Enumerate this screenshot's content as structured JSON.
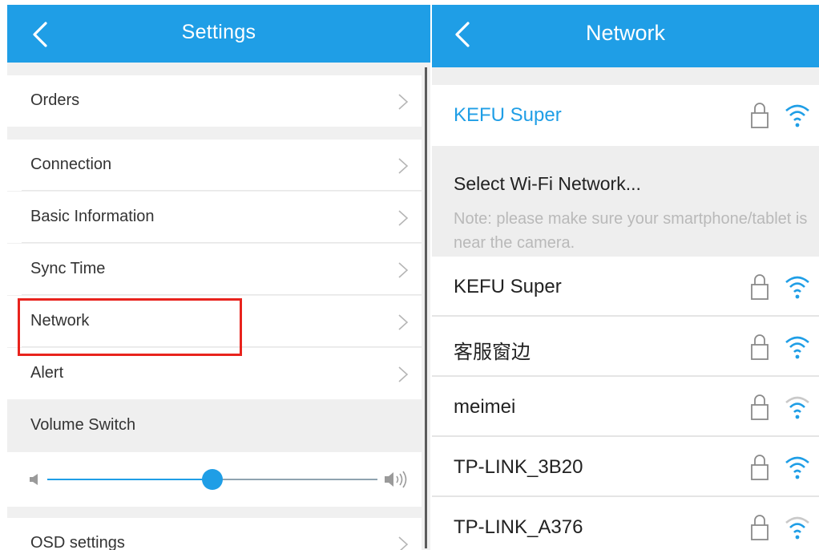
{
  "settings": {
    "title": "Settings",
    "items": [
      {
        "label": "Orders"
      },
      {
        "label": "Connection"
      },
      {
        "label": "Basic Information"
      },
      {
        "label": "Sync Time"
      },
      {
        "label": "Network"
      },
      {
        "label": "Alert"
      },
      {
        "label": "Volume Switch"
      },
      {
        "label": "OSD settings"
      }
    ],
    "volume_level": 0.5,
    "highlight_color": "#e8231d"
  },
  "network": {
    "title": "Network",
    "current_network": "KEFU Super",
    "select_heading": "Select Wi-Fi Network...",
    "select_note": "Note: please make sure your smartphone/tablet is near the camera.",
    "networks": [
      {
        "name": "KEFU Super"
      },
      {
        "name": "客服窗边"
      },
      {
        "name": "meimei"
      },
      {
        "name": "TP-LINK_3B20"
      },
      {
        "name": "TP-LINK_A376"
      }
    ]
  },
  "colors": {
    "accent": "#1f9ee6",
    "background": "#f0f0f0"
  },
  "icons": [
    "back-arrow-icon",
    "chevron-right-icon",
    "speaker-low-icon",
    "speaker-high-icon",
    "lock-icon",
    "wifi-icon"
  ]
}
